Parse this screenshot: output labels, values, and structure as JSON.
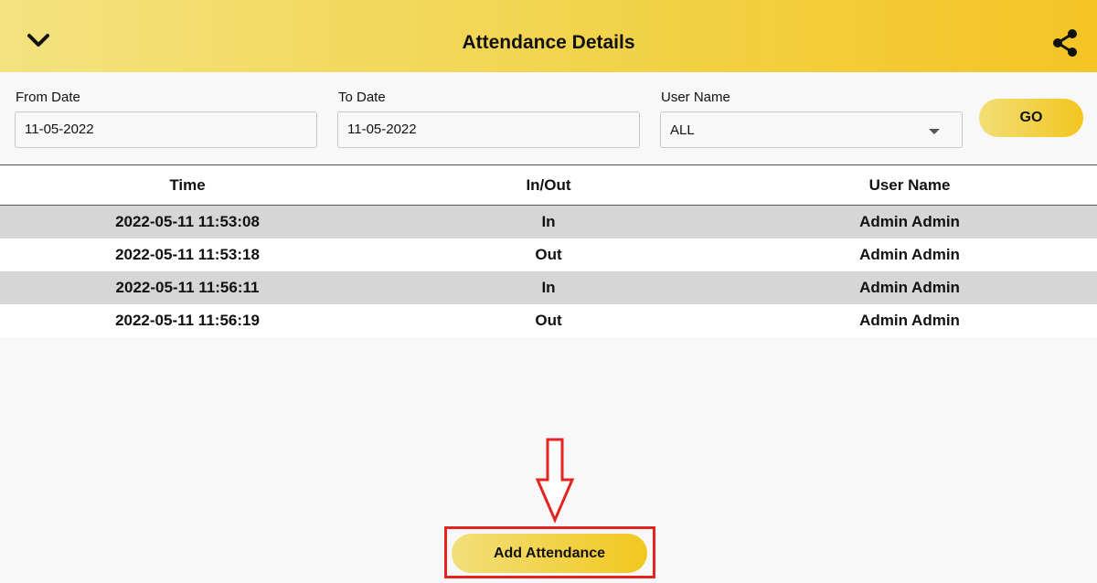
{
  "header": {
    "title": "Attendance Details",
    "back_icon": "chevron-down-icon",
    "share_icon": "share-icon"
  },
  "filters": {
    "from_date": {
      "label": "From Date",
      "value": "11-05-2022"
    },
    "to_date": {
      "label": "To Date",
      "value": "11-05-2022"
    },
    "user_name": {
      "label": "User Name",
      "value": "ALL"
    },
    "go_label": "GO"
  },
  "table": {
    "columns": [
      "Time",
      "In/Out",
      "User Name"
    ],
    "rows": [
      [
        "2022-05-11 11:53:08",
        "In",
        "Admin Admin"
      ],
      [
        "2022-05-11 11:53:18",
        "Out",
        "Admin Admin"
      ],
      [
        "2022-05-11 11:56:11",
        "In",
        "Admin Admin"
      ],
      [
        "2022-05-11 11:56:19",
        "Out",
        "Admin Admin"
      ]
    ]
  },
  "footer": {
    "add_label": "Add Attendance",
    "annotation_arrow_icon": "down-arrow-icon"
  },
  "colors": {
    "header_start": "#f3e27f",
    "header_end": "#f4c424",
    "highlight_border": "#e52420",
    "row_shade": "#d6d6d6"
  }
}
